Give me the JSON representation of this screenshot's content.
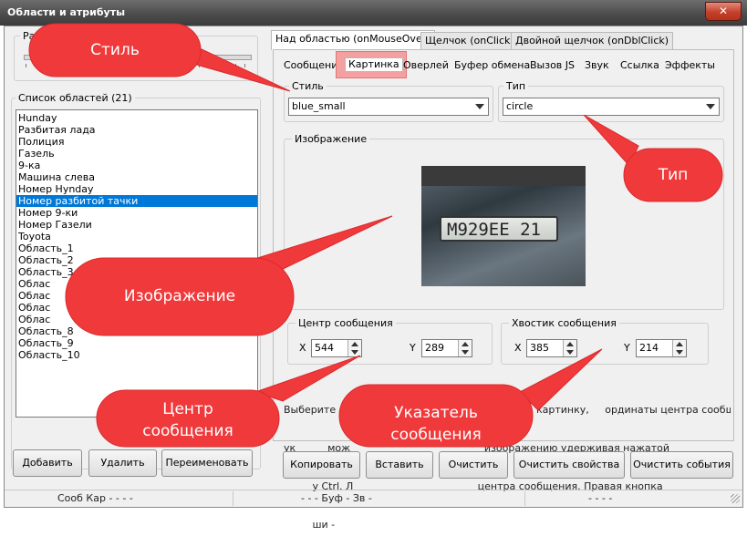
{
  "window": {
    "title": "Области и атрибуты",
    "close_glyph": "✕"
  },
  "left": {
    "top_group_label": "Ра",
    "list_label": "Список областей (21)",
    "items": [
      "Hunday",
      "Разбитая лада",
      "Полиция",
      "Газель",
      "9-ка",
      "Машина слева",
      "Номер Hynday",
      "Номер разбитой тачки",
      "Номер 9-ки",
      "Номер Газели",
      "Toyota",
      "Область_1",
      "Область_2",
      "Область_3",
      "Облас",
      "Облас",
      "Облас",
      "Облас",
      "Область_8",
      "Область_9",
      "Область_10"
    ],
    "selected_index": 7,
    "buttons": {
      "add": "Добавить",
      "delete": "Удалить",
      "rename": "Переименовать"
    }
  },
  "tabs": [
    "Над областью (onMouseOver)",
    "Щелчок (onClick)",
    "Двойной щелчок (onDblClick)"
  ],
  "subtabs": [
    "Сообщение",
    "Картинка",
    "Оверлей",
    "Буфер обмена",
    "Вызов JS",
    "Звук",
    "Ссылка",
    "Эффекты"
  ],
  "style_group": {
    "label": "Стиль",
    "value": "blue_small"
  },
  "type_group": {
    "label": "Тип",
    "value": "circle"
  },
  "image_group": {
    "label": "Изображение",
    "plate_text": "M929EE 21"
  },
  "center_group": {
    "label": "Центр сообщения",
    "x_label": "X",
    "x": "544",
    "y_label": "Y",
    "y": "289"
  },
  "tail_group": {
    "label": "Хвостик сообщения",
    "x_label": "X",
    "x": "385",
    "y_label": "Y",
    "y": "214"
  },
  "help_lines": [
    "Выберите ст    иль и тип сообщения, выберите картинку,     ординаты центра сообщения и его",
    "ук          мож                                          изображению удерживая нажатой",
    "         у Ctrl. Л                                       центра сообщения. Правая кнопка",
    "         ши -"
  ],
  "bottom_buttons": {
    "copy": "Копировать",
    "paste": "Вставить",
    "clear": "Очистить",
    "clear_props": "Очистить свойства",
    "clear_events": "Очистить события"
  },
  "status": {
    "left": "Сооб Кар  -  -  -  -",
    "mid": "-  -  -  Буф  -  Зв  -",
    "right": "-  -  -  -"
  },
  "callouts": {
    "style": "Стиль",
    "type": "Тип",
    "image": "Изображение",
    "center_l1": "Центр",
    "center_l2": "сообщения",
    "pointer_l1": "Указатель",
    "pointer_l2": "сообщения"
  },
  "colors": {
    "callout": "#f0393b",
    "selection": "#0078d7",
    "subtab_highlight": "#f4a0a0"
  }
}
